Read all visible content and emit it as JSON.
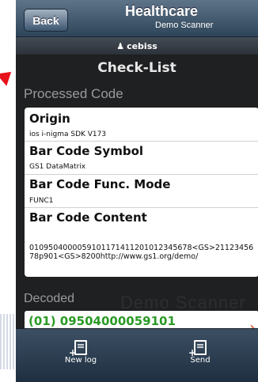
{
  "header": {
    "back_label": "Back",
    "title": "Healthcare",
    "subtitle": "Demo Scanner"
  },
  "user": {
    "name": "cebiss",
    "icon": "person-icon"
  },
  "page": {
    "title": "Check-List"
  },
  "processed": {
    "section_label": "Processed Code",
    "fields": [
      {
        "title": "Origin",
        "value": "ios i-nigma SDK V173"
      },
      {
        "title": "Bar Code Symbol",
        "value": "GS1 DataMatrix"
      },
      {
        "title": "Bar Code Func. Mode",
        "value": "FUNC1"
      },
      {
        "title": "Bar Code Content",
        "value": "0109504000059101171411201012345678<GS>2112345678p901<GS>8200http://www.gs1.org/demo/"
      }
    ]
  },
  "decoded": {
    "section_label": "Decoded",
    "watermark": "Demo Scanner",
    "first_item": "(01) 09504000059101"
  },
  "toolbar": {
    "new_log_label": "New log",
    "send_label": "Send"
  },
  "colors": {
    "accent_green": "#2a9a25",
    "header_blue": "#3f566d",
    "chevron": "#e05e32"
  }
}
